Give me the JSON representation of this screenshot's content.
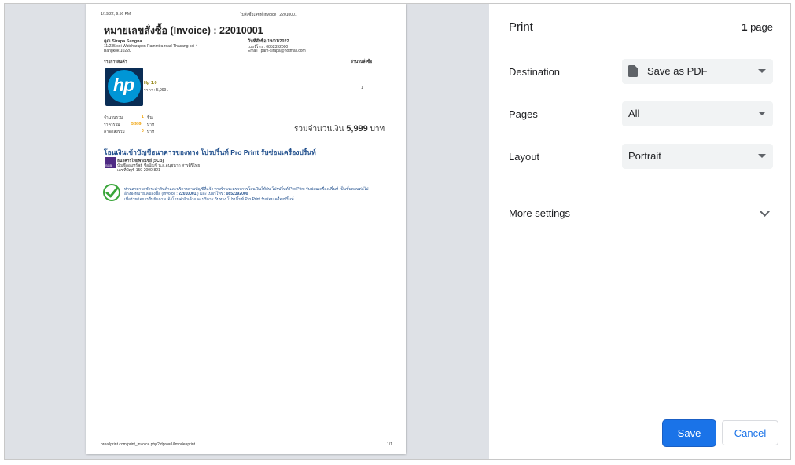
{
  "print_panel": {
    "title": "Print",
    "page_count_number": "1",
    "page_count_suffix": "page",
    "destination_label": "Destination",
    "destination_value": "Save as PDF",
    "pages_label": "Pages",
    "pages_value": "All",
    "layout_label": "Layout",
    "layout_value": "Portrait",
    "more_settings_label": "More settings",
    "save_button": "Save",
    "cancel_button": "Cancel"
  },
  "document": {
    "header_left": "1/19/22, 9:56 PM",
    "header_right": "ใบสั่งซื้อเลขที่ Invoice : 22010001",
    "title": "หมายเลขสั่งซื้อ (Invoice) : 22010001",
    "customer_name": "คุณ Sirapa Sangna",
    "customer_address1": "11/235 soi Watcharapon Ramintra road Thasang soi 4",
    "customer_address2": "Bangkok 10220",
    "order_date": "วันที่สั่งซื้อ 19/01/2022",
    "phone": "เบอร์โทร : 0852392000",
    "email": "Email : pam-sirapa@hotmail.com",
    "col_items": "รายการสินค้า",
    "col_qty": "จำนวนสั่งซื้อ",
    "product_logo_text": "hp",
    "product_name": "Hp 1.0",
    "product_price": "ราคา : 5,999 .-",
    "product_qty": "1",
    "sum_qty_label": "จำนวนรวม",
    "sum_qty_value": "1",
    "sum_qty_unit": "ชิ้น",
    "sum_price_label": "ราคารวม",
    "sum_price_value": "5,999",
    "sum_price_unit": "บาท",
    "shipping_label": "ค่าจัดส่งรวม",
    "shipping_value": "0",
    "shipping_unit": "บาท",
    "total_prefix": "รวมจำนวนเงิน",
    "total_value": "5,999",
    "total_unit": "บาท",
    "bank_heading": "โอนเงินเข้าบัญชีธนาคารของทาง โปรปริ้นท์ Pro Print รับซ่อมเครื่องปริ้นท์",
    "bank_logo_text": "SCB",
    "bank_name": "ธนาคารไทยพาณิชย์ (SCB)",
    "bank_branch": "บัญชีออมทรัพย์ ชื่อบัญชี น.ส.อนุชนาถ สารศิริไทย",
    "bank_account": "เลขที่บัญชี 159-2000-821",
    "note_line1": "ท่านสามารถชำระค่าสินค้าและบริการตามบัญชีที่แจ้ง ทางร้านจะตรวจการโอนเงินให้กับ โปรปริ้นท์ Pro Print รับซ่อมเครื่องปริ้นท์ เป็นขั้นตอนต่อไป",
    "note_line2_a": "อ้างอิงหมายเลขสั่งซื้อ (Invoice :",
    "note_line2_invoice": "22010001",
    "note_line2_b": ") และ เบอร์โทร :",
    "note_line2_phone": "0852392000",
    "note_line3": "เพื่อง่ายต่อการยืนยันการแจ้งโอนค่าสินค้าและ บริการ กับทาง โปรปริ้นท์ Pro Print รับซ่อมเครื่องปริ้นท์",
    "footer_left": "proallprint.com/print_invoice.php?idpro=1&mode=print",
    "footer_right": "1/1"
  },
  "colors": {
    "accent": "#1a73e8",
    "heading_blue": "#1f4e8c",
    "orange": "#f0a000",
    "hp_blue": "#0096d6",
    "scb_purple": "#4e2a84",
    "check_green": "#3aa53a"
  }
}
